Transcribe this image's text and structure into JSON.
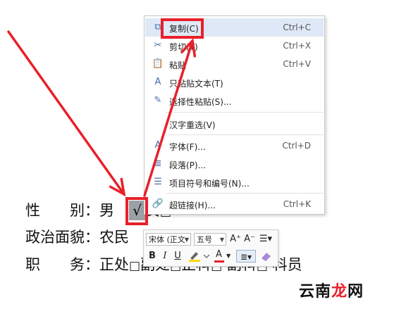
{
  "document": {
    "gender_row": {
      "label": "性　　别：",
      "male": "男",
      "check": "√",
      "female": "女",
      "female_box": "□"
    },
    "political_row": {
      "label": "政治面貌：",
      "value": "农民"
    },
    "position_row": {
      "label": "职　　务：",
      "options": [
        "正处",
        "副处",
        "正科",
        "副科",
        "科员"
      ],
      "box": "□"
    }
  },
  "context_menu": {
    "items": [
      {
        "label": "复制(C)",
        "shortcut": "Ctrl+C",
        "icon": "copy-icon",
        "glyph": "⧉",
        "hover": true
      },
      {
        "label": "剪切(T)",
        "shortcut": "Ctrl+X",
        "icon": "scissors-icon",
        "glyph": "✂"
      },
      {
        "label": "粘贴",
        "shortcut": "Ctrl+V",
        "icon": "paste-icon",
        "glyph": "📋"
      },
      {
        "label": "只粘贴文本(T)",
        "shortcut": "",
        "icon": "paste-text-icon",
        "glyph": "A"
      },
      {
        "label": "选择性粘贴(S)...",
        "shortcut": "",
        "icon": "paste-special-icon",
        "glyph": "✎"
      },
      {
        "label": "汉字重选(V)",
        "shortcut": "",
        "icon": "",
        "glyph": ""
      },
      {
        "label": "字体(F)...",
        "shortcut": "Ctrl+D",
        "icon": "font-icon",
        "glyph": "A"
      },
      {
        "label": "段落(P)...",
        "shortcut": "",
        "icon": "paragraph-icon",
        "glyph": "≣"
      },
      {
        "label": "项目符号和编号(N)...",
        "shortcut": "",
        "icon": "bullets-icon",
        "glyph": "☰"
      },
      {
        "label": "超链接(H)...",
        "shortcut": "Ctrl+K",
        "icon": "hyperlink-icon",
        "glyph": "🔗"
      }
    ]
  },
  "mini_toolbar": {
    "font_name": "宋体 (正文",
    "font_size": "五号",
    "grow_font": "A⁺",
    "shrink_font": "A⁻",
    "bold": "B",
    "italic": "I",
    "underline": "U",
    "highlight_icon": "highlighter-icon",
    "font_color_label": "A",
    "align_icon": "align-icon",
    "eraser_icon": "eraser-icon",
    "accent_colors": {
      "highlight": "#ffd800",
      "font_color": "#e8202a"
    }
  },
  "annotations": {
    "color": "#e8202a"
  },
  "watermark": {
    "part1": "云南",
    "part2": "龙",
    "part3": "网"
  }
}
